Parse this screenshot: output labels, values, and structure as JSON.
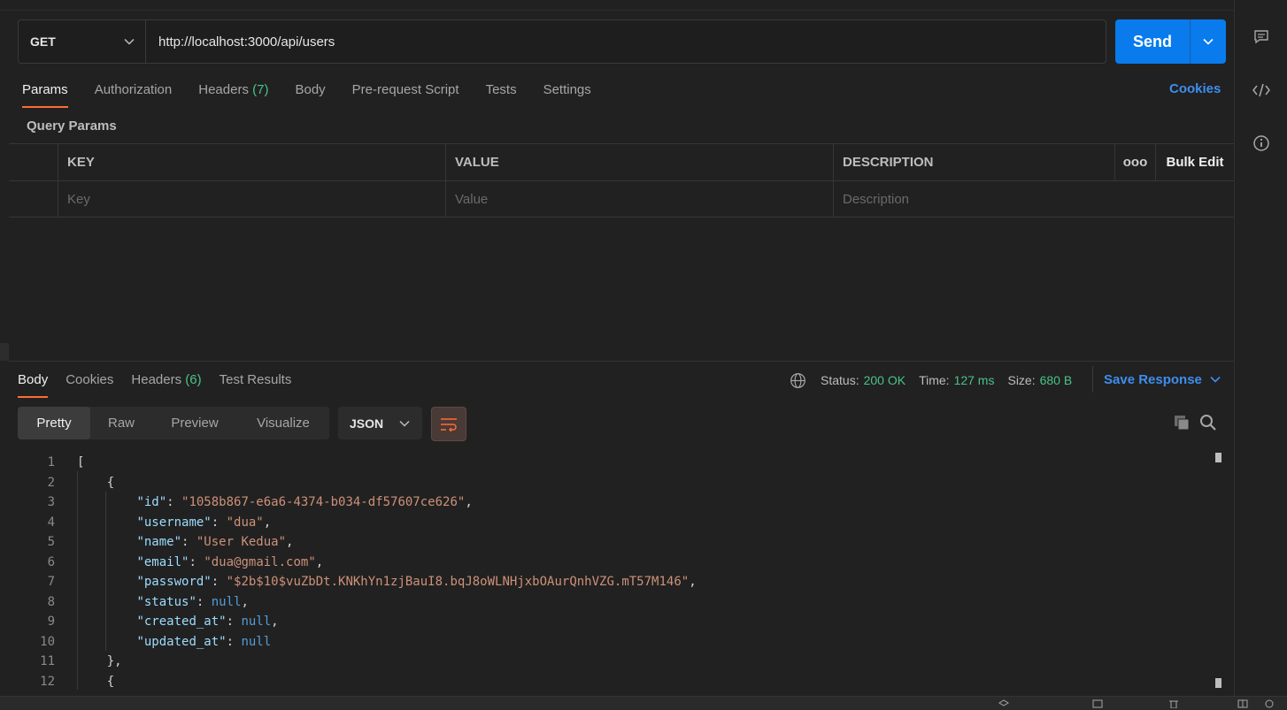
{
  "request": {
    "method": "GET",
    "url": "http://localhost:3000/api/users",
    "send_label": "Send"
  },
  "tabs": {
    "params": "Params",
    "authorization": "Authorization",
    "headers": "Headers",
    "headers_count": "(7)",
    "body": "Body",
    "pre_request": "Pre-request Script",
    "tests": "Tests",
    "settings": "Settings",
    "cookies": "Cookies"
  },
  "query_params": {
    "title": "Query Params",
    "headers": {
      "key": "KEY",
      "value": "VALUE",
      "description": "DESCRIPTION",
      "more": "ooo",
      "bulk_edit": "Bulk Edit"
    },
    "placeholders": {
      "key": "Key",
      "value": "Value",
      "description": "Description"
    }
  },
  "response": {
    "tabs": {
      "body": "Body",
      "cookies": "Cookies",
      "headers": "Headers",
      "headers_count": "(6)",
      "test_results": "Test Results"
    },
    "status_label": "Status:",
    "status_value": "200 OK",
    "time_label": "Time:",
    "time_value": "127 ms",
    "size_label": "Size:",
    "size_value": "680 B",
    "save_response": "Save Response",
    "views": {
      "pretty": "Pretty",
      "raw": "Raw",
      "preview": "Preview",
      "visualize": "Visualize"
    },
    "format": "JSON",
    "colors": {
      "accent": "#ff6c37",
      "link": "#3d8eef",
      "success": "#49c389",
      "send": "#097bed"
    }
  },
  "code_lines": [
    {
      "n": "1",
      "indent": "",
      "parts": [
        {
          "t": "p",
          "v": "["
        }
      ]
    },
    {
      "n": "2",
      "indent": "    ",
      "parts": [
        {
          "t": "p",
          "v": "{"
        }
      ]
    },
    {
      "n": "3",
      "indent": "        ",
      "parts": [
        {
          "t": "k",
          "v": "\"id\""
        },
        {
          "t": "p",
          "v": ": "
        },
        {
          "t": "s",
          "v": "\"1058b867-e6a6-4374-b034-df57607ce626\""
        },
        {
          "t": "p",
          "v": ","
        }
      ]
    },
    {
      "n": "4",
      "indent": "        ",
      "parts": [
        {
          "t": "k",
          "v": "\"username\""
        },
        {
          "t": "p",
          "v": ": "
        },
        {
          "t": "s",
          "v": "\"dua\""
        },
        {
          "t": "p",
          "v": ","
        }
      ]
    },
    {
      "n": "5",
      "indent": "        ",
      "parts": [
        {
          "t": "k",
          "v": "\"name\""
        },
        {
          "t": "p",
          "v": ": "
        },
        {
          "t": "s",
          "v": "\"User Kedua\""
        },
        {
          "t": "p",
          "v": ","
        }
      ]
    },
    {
      "n": "6",
      "indent": "        ",
      "parts": [
        {
          "t": "k",
          "v": "\"email\""
        },
        {
          "t": "p",
          "v": ": "
        },
        {
          "t": "s",
          "v": "\"dua@gmail.com\""
        },
        {
          "t": "p",
          "v": ","
        }
      ]
    },
    {
      "n": "7",
      "indent": "        ",
      "parts": [
        {
          "t": "k",
          "v": "\"password\""
        },
        {
          "t": "p",
          "v": ": "
        },
        {
          "t": "s",
          "v": "\"$2b$10$vuZbDt.KNKhYn1zjBauI8.bqJ8oWLNHjxbOAurQnhVZG.mT57M146\""
        },
        {
          "t": "p",
          "v": ","
        }
      ]
    },
    {
      "n": "8",
      "indent": "        ",
      "parts": [
        {
          "t": "k",
          "v": "\"status\""
        },
        {
          "t": "p",
          "v": ": "
        },
        {
          "t": "n",
          "v": "null"
        },
        {
          "t": "p",
          "v": ","
        }
      ]
    },
    {
      "n": "9",
      "indent": "        ",
      "parts": [
        {
          "t": "k",
          "v": "\"created_at\""
        },
        {
          "t": "p",
          "v": ": "
        },
        {
          "t": "n",
          "v": "null"
        },
        {
          "t": "p",
          "v": ","
        }
      ]
    },
    {
      "n": "10",
      "indent": "        ",
      "parts": [
        {
          "t": "k",
          "v": "\"updated_at\""
        },
        {
          "t": "p",
          "v": ": "
        },
        {
          "t": "n",
          "v": "null"
        }
      ]
    },
    {
      "n": "11",
      "indent": "    ",
      "parts": [
        {
          "t": "p",
          "v": "},"
        }
      ]
    },
    {
      "n": "12",
      "indent": "    ",
      "parts": [
        {
          "t": "p",
          "v": "{"
        }
      ]
    }
  ]
}
